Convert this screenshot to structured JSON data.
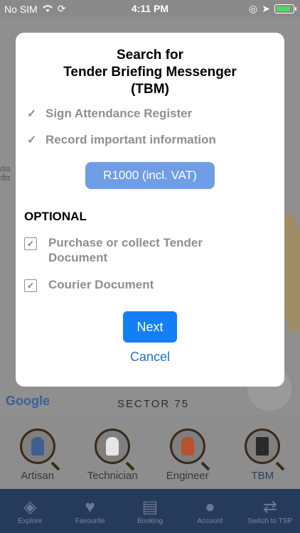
{
  "status_bar": {
    "carrier": "No SIM",
    "time": "4:11 PM"
  },
  "map": {
    "google_logo": "Google",
    "sector_label": "SECTOR 75",
    "edge_text": "dia\nजैव"
  },
  "modal": {
    "title_line1": "Search for",
    "title_line2": "Tender Briefing Messenger",
    "title_line3": "(TBM)",
    "included": [
      "Sign Attendance Register",
      "Record important information"
    ],
    "price_label": "R1000 (incl. VAT)",
    "optional_heading": "OPTIONAL",
    "optional_items": [
      {
        "line1": "Purchase or collect Tender",
        "line2": "Document",
        "checked": true
      },
      {
        "line1": "Courier Document",
        "line2": "",
        "checked": true
      }
    ],
    "next_label": "Next",
    "cancel_label": "Cancel"
  },
  "services": [
    {
      "label": "Artisan",
      "icon": "artisan-icon"
    },
    {
      "label": "Technician",
      "icon": "technician-icon"
    },
    {
      "label": "Engineer",
      "icon": "engineer-icon"
    },
    {
      "label": "TBM",
      "icon": "tbm-icon"
    }
  ],
  "tabbar": [
    {
      "label": "Explore",
      "icon": "compass-icon"
    },
    {
      "label": "Favourite",
      "icon": "heart-icon"
    },
    {
      "label": "Booking",
      "icon": "book-icon"
    },
    {
      "label": "Account",
      "icon": "person-icon"
    },
    {
      "label": "Switch to TSP",
      "icon": "swap-icon"
    }
  ],
  "colors": {
    "primary_button": "#147ef6",
    "price_button": "#6f9de6",
    "tabbar_bg": "#263b5c"
  }
}
